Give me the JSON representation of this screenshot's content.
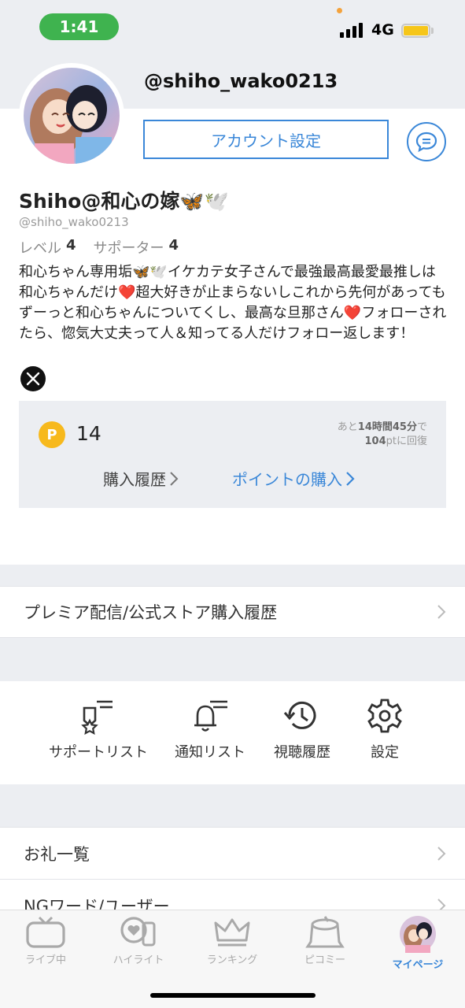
{
  "status_bar": {
    "time": "1:41",
    "network": "4G"
  },
  "profile": {
    "handle_top": "@shiho_wako0213",
    "account_settings_label": "アカウント設定",
    "display_name": "Shiho@和心の嫁🦋🕊️",
    "handle": "@shiho_wako0213",
    "level_label": "レベル",
    "level_value": "4",
    "supporter_label": "サポーター",
    "supporter_value": "4",
    "bio": "和心ちゃん専用垢🦋🕊️イケカテ女子さんで最強最高最愛最推しは和心ちゃんだけ❤️超大好きが止まらないしこれから先何があってもずーっと和心ちゃんについてくし、最高な旦那さん❤️フォローされたら、惚気大丈夫って人＆知ってる人だけフォロー返します！"
  },
  "points": {
    "coin_symbol": "P",
    "value": "14",
    "recover_prefix": "あと",
    "recover_time": "14時間45分",
    "recover_mid": "で",
    "recover_amount": "104",
    "recover_suffix": "ptに回復",
    "history_label": "購入履歴",
    "buy_label": "ポイントの購入"
  },
  "menu": {
    "premium_history": "プレミア配信/公式ストア購入履歴",
    "thanks_list": "お礼一覧",
    "ng_words": "NGワード/ユーザー"
  },
  "shortcuts": [
    {
      "label": "サポートリスト",
      "icon": "support-list-icon"
    },
    {
      "label": "通知リスト",
      "icon": "bell-list-icon"
    },
    {
      "label": "視聴履歴",
      "icon": "history-icon"
    },
    {
      "label": "設定",
      "icon": "gear-icon"
    }
  ],
  "tabs": [
    {
      "label": "ライブ中",
      "icon": "tv-icon"
    },
    {
      "label": "ハイライト",
      "icon": "highlight-icon"
    },
    {
      "label": "ランキング",
      "icon": "crown-icon"
    },
    {
      "label": "ピコミー",
      "icon": "stump-icon"
    },
    {
      "label": "マイページ",
      "icon": "avatar-icon"
    }
  ],
  "colors": {
    "accent": "#3a87d8",
    "coin": "#f7b91d",
    "status_pill": "#3fb34f",
    "background_gray": "#eceef2"
  }
}
